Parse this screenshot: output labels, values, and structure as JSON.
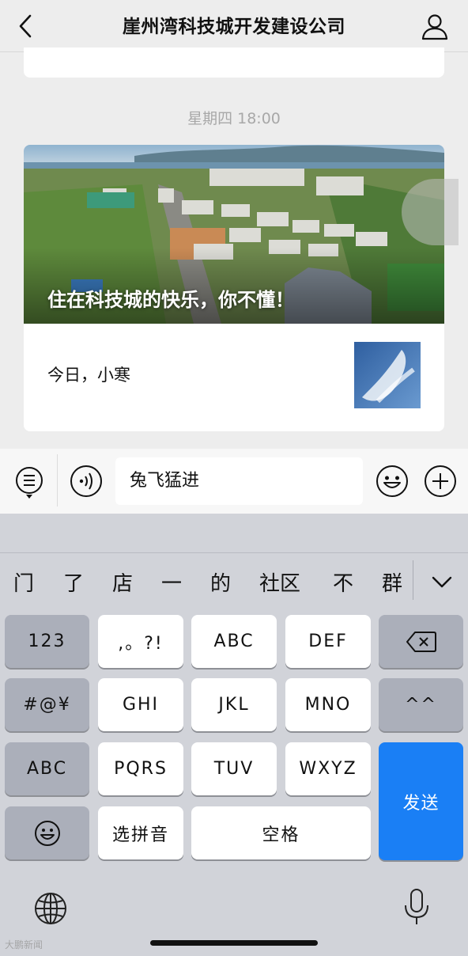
{
  "header": {
    "title": "崖州湾科技城开发建设公司",
    "back_icon": "chevron-left-icon",
    "profile_icon": "person-icon"
  },
  "chat": {
    "timestamp": "星期四 18:00",
    "article": {
      "cover_title": "住在科技城的快乐，你不懂！",
      "sub_title": "今日，小寒"
    }
  },
  "input_bar": {
    "value": "兔飞猛进",
    "menu_icon": "menu-list-icon",
    "voice_icon": "voice-icon",
    "emoji_icon": "emoji-icon",
    "plus_icon": "plus-icon"
  },
  "keyboard": {
    "candidates": [
      "门",
      "了",
      "店",
      "一",
      "的",
      "社区",
      "不",
      "群"
    ],
    "keys": {
      "num": "123",
      "punct": ",。?!",
      "abc": "ABC",
      "def": "DEF",
      "symbols": "#@¥",
      "ghi": "GHI",
      "jkl": "JKL",
      "mno": "MNO",
      "kaomoji": "^^",
      "abc_switch": "ABC",
      "pqrs": "PQRS",
      "tuv": "TUV",
      "wxyz": "WXYZ",
      "send": "发送",
      "pinyin": "选拼音",
      "space": "空格"
    }
  },
  "watermark": "大鹏新闻",
  "colors": {
    "send_key": "#1a7ff5",
    "keyboard_bg": "#d1d3d9",
    "chat_bg": "#ededed"
  }
}
